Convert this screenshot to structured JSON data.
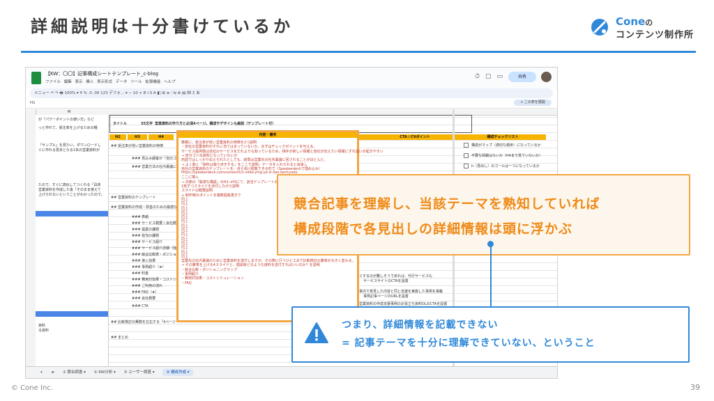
{
  "slide": {
    "title": "詳細説明は十分書けているか",
    "footer_left": "© Cone Inc.",
    "page_number": "39"
  },
  "logo": {
    "top": "Cone",
    "top_suffix": "の",
    "bottom": "コンテンツ制作所"
  },
  "sheet": {
    "doc_title": "【KW：〇〇】記事構成シートテンプレート_c-blog",
    "menu": [
      "ファイル",
      "編集",
      "表示",
      "挿入",
      "表示形式",
      "データ",
      "ツール",
      "拡張機能",
      "ヘルプ"
    ],
    "share": "共有",
    "toolbar": "メニュー   ↶  ↷  🖶   100%  ▾   ¥   %   .0   .00   123   デフォ...  ▾   −  10  +   B   I   S   A   ◧   ⊞   ≡   ⫶   ⇆   ⊕   ▤   ⌧   Σ   あ",
    "cell_ref": "H1",
    "add_sheet": "+ この表を展開",
    "col_m": "M",
    "title_label": "タイトル",
    "title_chars": "35文字",
    "title_text": "営業資料の作り方と必須4ページ。構成やデザインも解説（テンプレート付）",
    "headers": [
      "H2",
      "H3",
      "H4",
      "内容・備考",
      "CTA / CVポイント",
      "構成チェックリスト"
    ],
    "left_col": [
      "が「パワーポイントの使い方」など",
      "っと作れて、受注率を上げるための種",
      "「サンプル」を見たい。ダウンロードし",
      "ぐに作れる見本となる1本の営業資料が",
      "たので、すぐに真似してつくれる「具体",
      "営業資料を作成した後「そのまま使えて",
      "上げられないということがわかったので。"
    ],
    "left_col_2": [
      "資料",
      "る資料"
    ],
    "rows": [
      "## 受注率が低い営業資料の特徴",
      "### 見込み顧客が「自分ゴト化",
      "### 営業方法の社内裏議に必要な",
      "## 営業資料のテンプレート",
      "## 営業資料の作成・改善のための最適な構成",
      "### 表紙",
      "### サービス概要 / 会社概要",
      "### 提案の課題",
      "### 担当の課題",
      "### サービス紹介",
      "### サービス紹介詳細（強み・ドラ",
      "### 競合比較表・ポジショニング",
      "### 導入効果",
      "### 事例紹介（★）",
      "### 料金",
      "### 費用対効果・コストシミュ",
      "### ご利用の流れ",
      "### FAQ（★）",
      "### 会社概要",
      "### CTA",
      "## 比較検討の費数を左右する「4ページ",
      "## まとめ"
    ],
    "notes": [
      "着眼に、受注率が低い営業資料の特徴を2つ説明",
      "・自社の営業資料がそれに当てはまっていないか、まずはチェックポイントを与える。",
      "サービス提供側は自社のサービスをだれよりも知っているため、相手が欲しい情報と自社が伝えたい情報にずれ違いが起きやすい",
      "→ 自分ゴト化資料になっていないか",
      "商談ではしっかり伝えられたとしても、結局は営業先の社内稟議に回されることがほとんど。",
      "→ よく聞く「資料は独り歩きする」をここで説明。データを入れられると尚良し",
      "自社の営業資料のテンプレートを、自らあけ閲覧できる形で（Speakerdeckで埋め込み）",
      "https://speakerdeck.com/conexinc/c-slide-ying-ye-zi-liao-tenhureto",
      "ここに挿入",
      "→ 次節の「最適な構成」のH2→H3にて、該当テンプレートの...",
      "1枚ずつスライドを添付しながら説明",
      "スライドの概要説明",
      "+ 制作時のポイントを複数個各書きで",
      "同上",
      "同上",
      "同上",
      "同上",
      "同上",
      "同上",
      "同上",
      "同上",
      "同上",
      "同上",
      "同上",
      "同上",
      "同上",
      "同上",
      "営業先の社内裏議のために営業資料を送付しますが、その際に行うひと工夫で比較検討の勝率が大きく変わる。",
      "→ その勝率を上げる4スライドと、理由後どのような資料を送付すればいいのか？を説明",
      "・競合比較・ポジショニングマップ",
      "・事例紹介",
      "・費用対効果・コストシミュレーション",
      "・FAQ"
    ],
    "cta": [
      "ぐするのが難しそうであれば、代行サービスも",
      "サービスサイトのCTAを設置",
      "事内で意見した内容と同じ支援を実施した事例を掲載",
      "事例記事ページのURLを設置",
      "営業資料の作成支援事例のお役立ち資料DLのCTAを設置"
    ],
    "checklist": [
      "構成がマップ（適切な順序）になっているか",
      "不要な情報はないか（H4まで見ていないか）",
      "h（見出し）のゴールは一つになっているか"
    ],
    "tabs": [
      "+",
      "≡",
      "① 競合調査 ▾",
      "② KW分析 ▾",
      "③ ユーザー調査 ▾",
      "④ 構成作成 ▾"
    ]
  },
  "callout_orange": {
    "line1": "競合記事を理解し、当該テーマを熟知していれば",
    "line2": "構成段階で各見出しの詳細情報は頭に浮かぶ"
  },
  "callout_blue": {
    "line1": "つまり、詳細情報を記載できない",
    "line2": "= 記事テーマを十分に理解できていない、ということ"
  },
  "colors": {
    "accent_blue": "#2f88d8",
    "accent_orange": "#ef8a17",
    "sheet_yellow": "#f6b400"
  }
}
